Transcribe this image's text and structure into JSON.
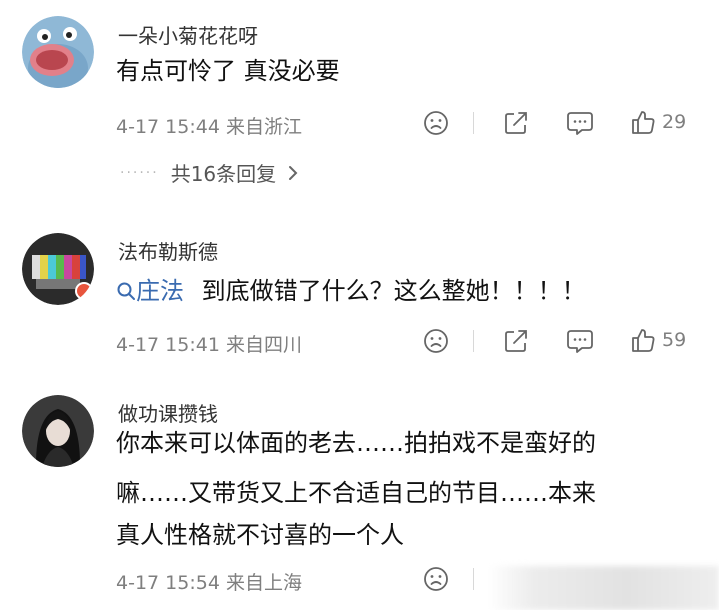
{
  "comments": [
    {
      "username": "一朵小菊花花呀",
      "text_lines": [
        "有点可怜了 真没必要"
      ],
      "meta": "4-17 15:44 来自浙江",
      "like_count": "29",
      "replies": "共16条回复"
    },
    {
      "username": "法布勒斯德",
      "mention": "庄法",
      "text_lines": [
        "到底做错了什么？这么整她！！！！"
      ],
      "meta": "4-17 15:41 来自四川",
      "like_count": "59"
    },
    {
      "username": "做功课攒钱",
      "text_lines": [
        "你本来可以体面的老去……拍拍戏不是蛮好的",
        "嘛……又带货又上不合适自己的节目……本来",
        "真人性格就不讨喜的一个人"
      ],
      "meta": "4-17 15:54 来自上海"
    }
  ],
  "icons": {
    "mention": "search-icon",
    "dislike": "sad-face-icon",
    "share": "share-icon",
    "comment": "comment-icon",
    "like": "thumbs-up-icon",
    "replies": "chevron-right-icon"
  }
}
